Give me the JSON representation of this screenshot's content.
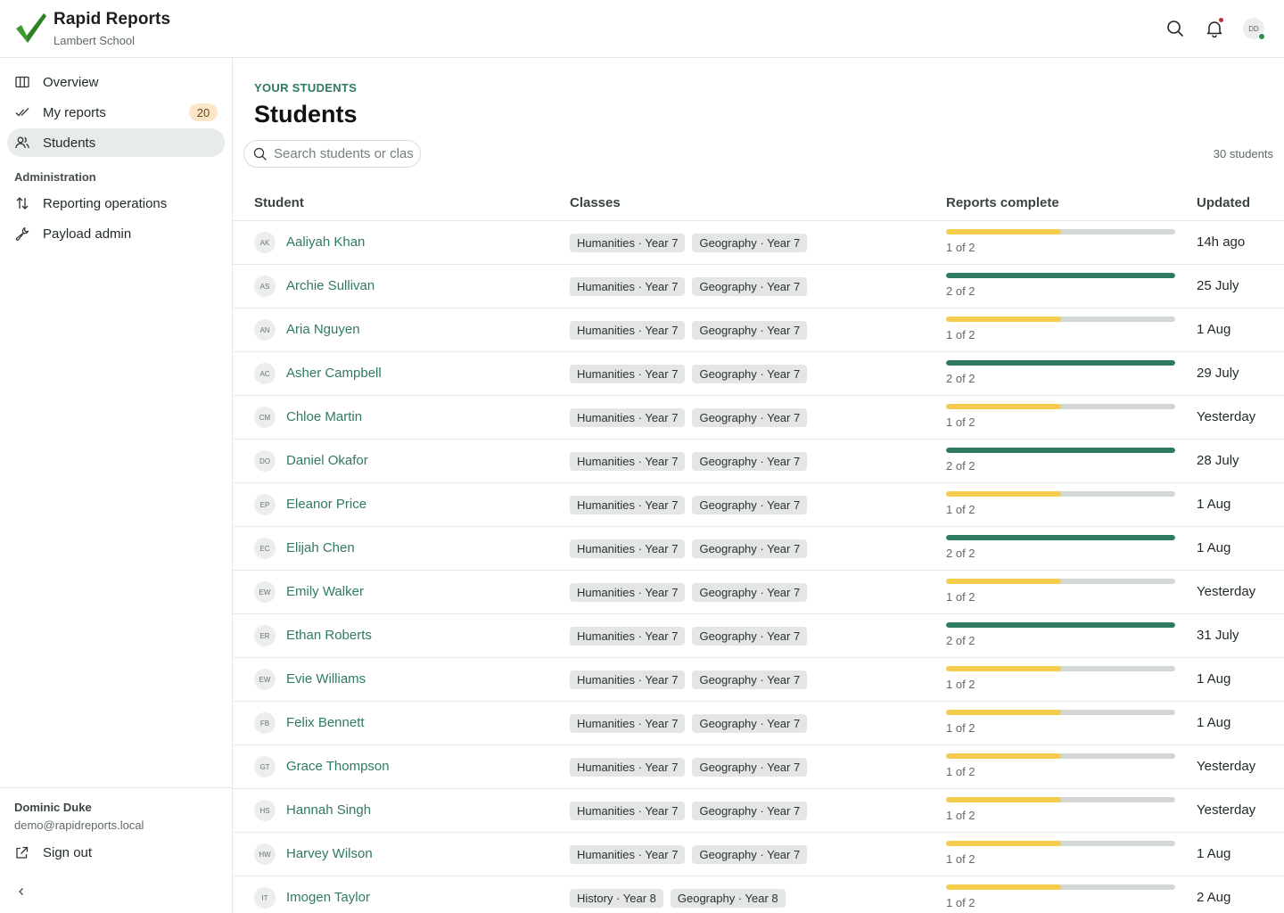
{
  "app": {
    "title": "Rapid Reports",
    "school": "Lambert School",
    "user_initials": "DD",
    "colors": {
      "accent": "#2f7a62",
      "progress_complete": "#2f7a62",
      "progress_partial": "#f4cd4f",
      "progress_track": "#d3d8d5",
      "badge_bg": "#fbe6c8"
    }
  },
  "sidebar": {
    "items": [
      {
        "label": "Overview",
        "icon": "columns-icon"
      },
      {
        "label": "My reports",
        "icon": "double-check-icon",
        "badge": "20"
      },
      {
        "label": "Students",
        "icon": "users-icon",
        "active": true
      }
    ],
    "section_label": "Administration",
    "admin_items": [
      {
        "label": "Reporting operations",
        "icon": "arrows-updown-icon"
      },
      {
        "label": "Payload admin",
        "icon": "wrench-icon"
      }
    ],
    "footer": {
      "user_name": "Dominic Duke",
      "user_email": "demo@rapidreports.local",
      "signout_label": "Sign out"
    }
  },
  "main": {
    "eyebrow": "YOUR STUDENTS",
    "title": "Students",
    "search_placeholder": "Search students or clas",
    "count": "30 students",
    "columns": [
      "Student",
      "Classes",
      "Reports complete",
      "Updated"
    ],
    "rows": [
      {
        "initials": "AK",
        "name": "Aaliyah Khan",
        "classes": [
          "Humanities · Year 7",
          "Geography · Year 7"
        ],
        "done": 1,
        "total": 2,
        "label": "1 of 2",
        "updated": "14h ago"
      },
      {
        "initials": "AS",
        "name": "Archie Sullivan",
        "classes": [
          "Humanities · Year 7",
          "Geography · Year 7"
        ],
        "done": 2,
        "total": 2,
        "label": "2 of 2",
        "updated": "25 July"
      },
      {
        "initials": "AN",
        "name": "Aria Nguyen",
        "classes": [
          "Humanities · Year 7",
          "Geography · Year 7"
        ],
        "done": 1,
        "total": 2,
        "label": "1 of 2",
        "updated": "1 Aug"
      },
      {
        "initials": "AC",
        "name": "Asher Campbell",
        "classes": [
          "Humanities · Year 7",
          "Geography · Year 7"
        ],
        "done": 2,
        "total": 2,
        "label": "2 of 2",
        "updated": "29 July"
      },
      {
        "initials": "CM",
        "name": "Chloe Martin",
        "classes": [
          "Humanities · Year 7",
          "Geography · Year 7"
        ],
        "done": 1,
        "total": 2,
        "label": "1 of 2",
        "updated": "Yesterday"
      },
      {
        "initials": "DO",
        "name": "Daniel Okafor",
        "classes": [
          "Humanities · Year 7",
          "Geography · Year 7"
        ],
        "done": 2,
        "total": 2,
        "label": "2 of 2",
        "updated": "28 July"
      },
      {
        "initials": "EP",
        "name": "Eleanor Price",
        "classes": [
          "Humanities · Year 7",
          "Geography · Year 7"
        ],
        "done": 1,
        "total": 2,
        "label": "1 of 2",
        "updated": "1 Aug"
      },
      {
        "initials": "EC",
        "name": "Elijah Chen",
        "classes": [
          "Humanities · Year 7",
          "Geography · Year 7"
        ],
        "done": 2,
        "total": 2,
        "label": "2 of 2",
        "updated": "1 Aug"
      },
      {
        "initials": "EW",
        "name": "Emily Walker",
        "classes": [
          "Humanities · Year 7",
          "Geography · Year 7"
        ],
        "done": 1,
        "total": 2,
        "label": "1 of 2",
        "updated": "Yesterday"
      },
      {
        "initials": "ER",
        "name": "Ethan Roberts",
        "classes": [
          "Humanities · Year 7",
          "Geography · Year 7"
        ],
        "done": 2,
        "total": 2,
        "label": "2 of 2",
        "updated": "31 July"
      },
      {
        "initials": "EW",
        "name": "Evie Williams",
        "classes": [
          "Humanities · Year 7",
          "Geography · Year 7"
        ],
        "done": 1,
        "total": 2,
        "label": "1 of 2",
        "updated": "1 Aug"
      },
      {
        "initials": "FB",
        "name": "Felix Bennett",
        "classes": [
          "Humanities · Year 7",
          "Geography · Year 7"
        ],
        "done": 1,
        "total": 2,
        "label": "1 of 2",
        "updated": "1 Aug"
      },
      {
        "initials": "GT",
        "name": "Grace Thompson",
        "classes": [
          "Humanities · Year 7",
          "Geography · Year 7"
        ],
        "done": 1,
        "total": 2,
        "label": "1 of 2",
        "updated": "Yesterday"
      },
      {
        "initials": "HS",
        "name": "Hannah Singh",
        "classes": [
          "Humanities · Year 7",
          "Geography · Year 7"
        ],
        "done": 1,
        "total": 2,
        "label": "1 of 2",
        "updated": "Yesterday"
      },
      {
        "initials": "HW",
        "name": "Harvey Wilson",
        "classes": [
          "Humanities · Year 7",
          "Geography · Year 7"
        ],
        "done": 1,
        "total": 2,
        "label": "1 of 2",
        "updated": "1 Aug"
      },
      {
        "initials": "IT",
        "name": "Imogen Taylor",
        "classes": [
          "History · Year 8",
          "Geography · Year 8"
        ],
        "done": 1,
        "total": 2,
        "label": "1 of 2",
        "updated": "2 Aug"
      }
    ]
  }
}
